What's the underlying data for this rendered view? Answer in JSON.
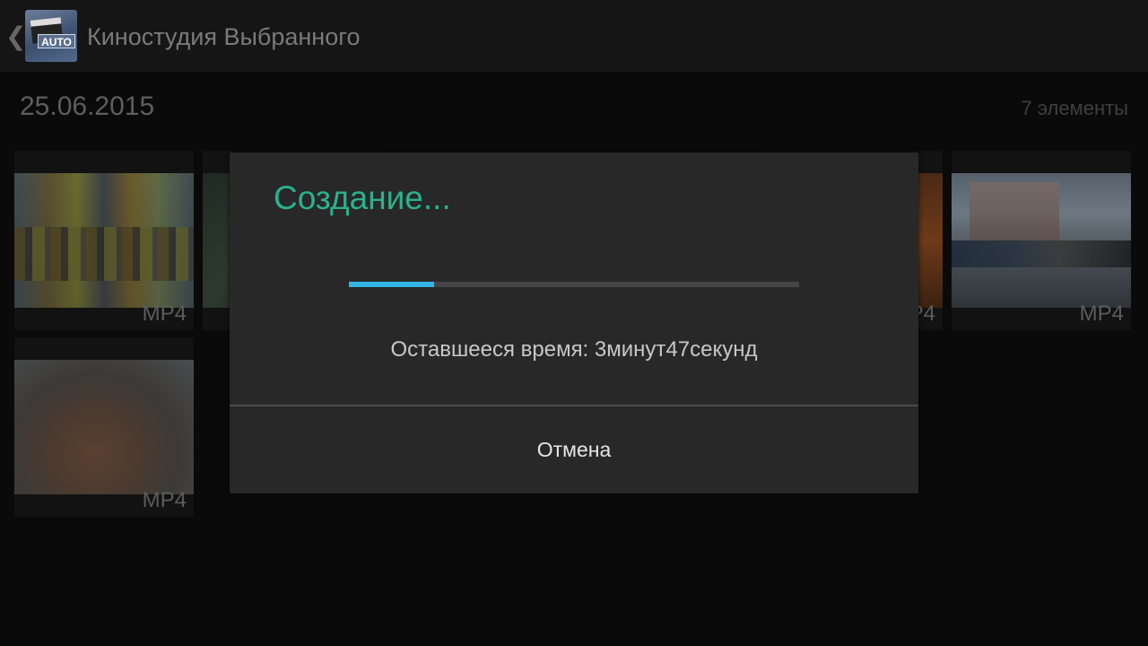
{
  "action_bar": {
    "title": "Киностудия Выбранного",
    "app_icon_label": "AUTO",
    "up_icon": "chevron-left-icon"
  },
  "section": {
    "date": "25.06.2015",
    "count": "7 элементы"
  },
  "thumbnails": [
    {
      "format": "MP4"
    },
    {
      "format": "MP4"
    },
    {
      "format": "MP4"
    },
    {
      "format": "MP4"
    },
    {
      "format": "MP4"
    }
  ],
  "dialog": {
    "title": "Создание...",
    "progress": 0.19,
    "remaining_text": "Оставшееся время: 3минут47секунд",
    "cancel_label": "Отмена"
  },
  "colors": {
    "accent_title": "#2bb289",
    "progress": "#33b5e5"
  }
}
